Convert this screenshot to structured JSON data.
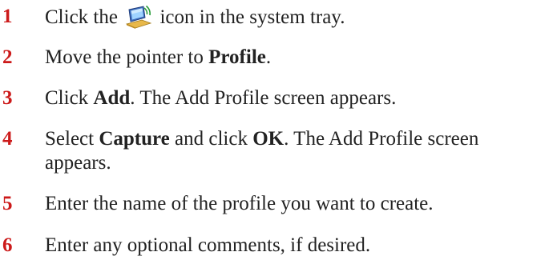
{
  "steps": [
    {
      "number": "1",
      "before": "Click the",
      "icon": "wireless-network-monitor-icon",
      "after": "icon in the system tray."
    },
    {
      "number": "2",
      "before": "Move the pointer to ",
      "bold1": "Profile",
      "after": "."
    },
    {
      "number": "3",
      "before": "Click ",
      "bold1": "Add",
      "after": ". The Add Profile screen appears."
    },
    {
      "number": "4",
      "before": "Select ",
      "bold1": "Capture",
      "middle": " and click ",
      "bold2": "OK",
      "after": ". The Add Profile screen appears."
    },
    {
      "number": "5",
      "text": "Enter the name of the profile you want to create."
    },
    {
      "number": "6",
      "text": "Enter any optional comments, if desired."
    }
  ],
  "colors": {
    "step_number": "#cc1a1a",
    "body_text": "#222222"
  }
}
